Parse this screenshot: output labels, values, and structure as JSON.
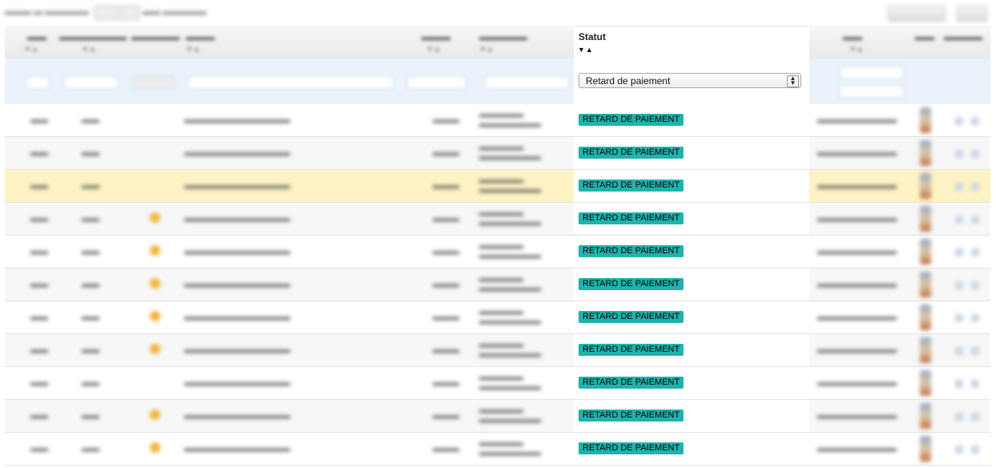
{
  "statut": {
    "title": "Statut",
    "sort_arrows": "▼▲",
    "filter_value": "Retard de paiement",
    "filter_arrow": "▴▾"
  },
  "rows": [
    {
      "badge": "RETARD DE PAIEMENT",
      "star": false,
      "highlight": false
    },
    {
      "badge": "RETARD DE PAIEMENT",
      "star": false,
      "highlight": false
    },
    {
      "badge": "RETARD DE PAIEMENT",
      "star": false,
      "highlight": true
    },
    {
      "badge": "RETARD DE PAIEMENT",
      "star": true,
      "highlight": false
    },
    {
      "badge": "RETARD DE PAIEMENT",
      "star": true,
      "highlight": false
    },
    {
      "badge": "RETARD DE PAIEMENT",
      "star": true,
      "highlight": false
    },
    {
      "badge": "RETARD DE PAIEMENT",
      "star": true,
      "highlight": false
    },
    {
      "badge": "RETARD DE PAIEMENT",
      "star": true,
      "highlight": false
    },
    {
      "badge": "RETARD DE PAIEMENT",
      "star": false,
      "highlight": false
    },
    {
      "badge": "RETARD DE PAIEMENT",
      "star": true,
      "highlight": false
    },
    {
      "badge": "RETARD DE PAIEMENT",
      "star": true,
      "highlight": false
    }
  ],
  "colors": {
    "badge_bg": "#1fb3ad",
    "highlight_row": "#fdf3c4",
    "filter_row": "#eaf3fb"
  },
  "icons": {
    "star": "star-icon",
    "pdf": "pdf-icon",
    "sort": "sort-arrows-icon",
    "select_arrow": "select-arrow-icon"
  }
}
